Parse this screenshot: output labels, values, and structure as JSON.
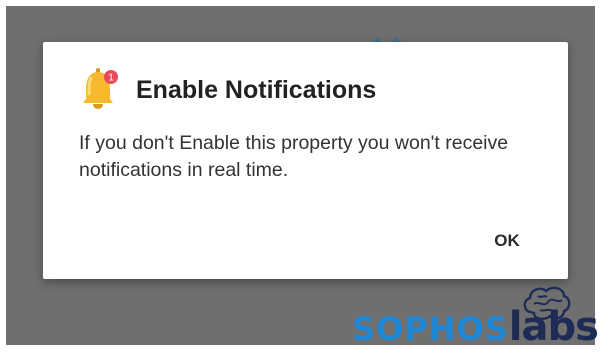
{
  "dialog": {
    "title": "Enable Notifications",
    "message": "If you don't Enable this property you won't receive notifications in real time.",
    "ok_label": "OK",
    "bell_badge": "1"
  },
  "watermark": {
    "part1": "SOPHOS",
    "part2": "labs"
  },
  "icons": {
    "bell": "bell-icon",
    "brand": "brain-logo-icon"
  },
  "colors": {
    "backdrop": "#6f6f6f",
    "dialog_bg": "#ffffff",
    "bell": "#f5b82e",
    "badge": "#e94b5a",
    "sophos_blue": "#1e88d6",
    "labs_navy": "#1e2c55"
  }
}
